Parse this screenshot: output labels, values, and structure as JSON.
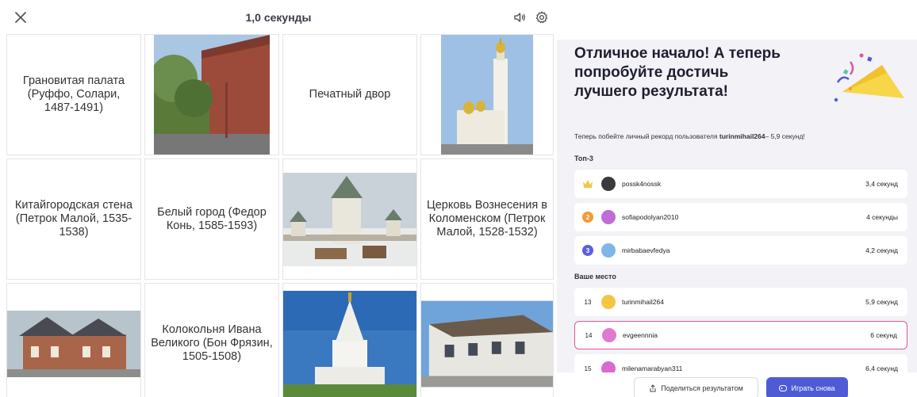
{
  "topbar": {
    "timer": "1,0 секунды",
    "icons": [
      "close-icon",
      "sound-icon",
      "settings-icon"
    ]
  },
  "grid": {
    "cells": [
      {
        "text": "Грановитая палата (Руффо, Солари, 1487-1491)"
      },
      {
        "image": "kitay-gorod-wall-photo"
      },
      {
        "text": "Печатный двор"
      },
      {
        "image": "ivan-the-great-bell-tower-photo"
      },
      {
        "text": "Китайгородская стена (Петрок Малой, 1535-1538)"
      },
      {
        "text": "Белый город (Федор Конь, 1585-1593)"
      },
      {
        "image": "white-city-tower-painting"
      },
      {
        "text": "Церковь Вознесения в Коломенском (Петрок Малой, 1528-1532)"
      },
      {
        "image": "print-yard-building-photo"
      },
      {
        "text": "Колокольня Ивана Великого (Бон Фрязин, 1505-1508)"
      },
      {
        "image": "kolomenskoye-church-photo"
      },
      {
        "image": "faceted-chamber-photo"
      }
    ]
  },
  "panel": {
    "headline": "Отличное начало! А теперь попробуйте достичь лучшего результата!",
    "sub_prefix": "Теперь побейте личный рекорд пользователя",
    "sub_user": "turinmihail264",
    "sub_suffix": "– 5,9 секунд!",
    "top_label": "Топ-3",
    "your_place_label": "Ваше место",
    "top": [
      {
        "rank": "1",
        "name": "possk4nossk",
        "score": "3,4 секунд",
        "medal_color": "#f4c542"
      },
      {
        "rank": "2",
        "name": "sofiapodolyan2010",
        "score": "4 секунды",
        "medal_color": "#f39a3a"
      },
      {
        "rank": "3",
        "name": "mirbabaevfedya",
        "score": "4,2 секунд",
        "medal_color": "#5a5fe0"
      }
    ],
    "places": [
      {
        "rank": "13",
        "name": "turinmihail264",
        "score": "5,9 секунд"
      },
      {
        "rank": "14",
        "name": "evgeennnia",
        "score": "6 секунд"
      },
      {
        "rank": "15",
        "name": "milenamarabyan311",
        "score": "6,4 секунд"
      }
    ]
  },
  "buttons": {
    "share": "Поделиться результатом",
    "play": "Играть снова"
  },
  "colors": {
    "accent": "#4f5bd5",
    "highlight_border": "#e0559a",
    "panel_bg": "#f2f2f7"
  }
}
